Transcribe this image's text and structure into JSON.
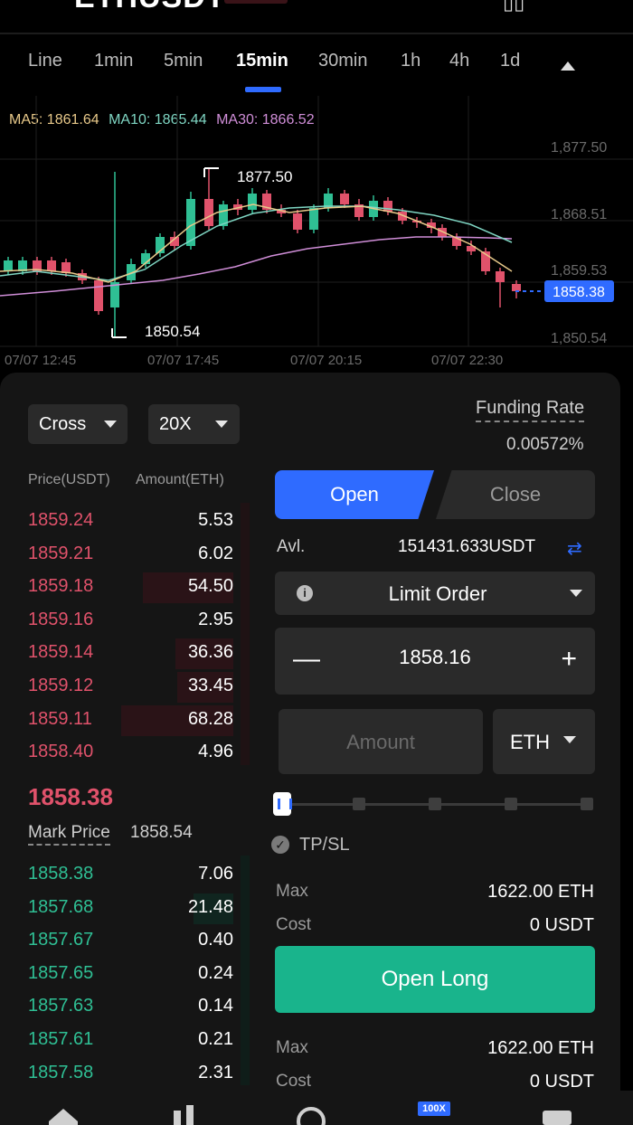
{
  "header": {
    "pair": "ETHUSDT"
  },
  "tabs": [
    {
      "label": "Line"
    },
    {
      "label": "1min"
    },
    {
      "label": "5min"
    },
    {
      "label": "15min",
      "active": true
    },
    {
      "label": "30min"
    },
    {
      "label": "1h"
    },
    {
      "label": "4h"
    },
    {
      "label": "1d"
    }
  ],
  "chart": {
    "ma5_label": "MA5: 1861.64",
    "ma10_label": "MA10: 1865.44",
    "ma30_label": "MA30: 1866.52",
    "y_ticks": [
      "1,877.50",
      "1,868.51",
      "1,859.53",
      "1,850.54"
    ],
    "x_ticks": [
      "07/07 12:45",
      "07/07 17:45",
      "07/07 20:15",
      "07/07 22:30"
    ],
    "high_label": "1877.50",
    "low_label": "1850.54",
    "current_price_tag": "1858.38",
    "colors": {
      "up": "#2fbf94",
      "down": "#e0526b",
      "ma5": "#e8c98a",
      "ma10": "#7fd6c3",
      "ma30": "#d08ed8",
      "tag": "#2f6bff"
    }
  },
  "trade": {
    "margin_mode": "Cross",
    "leverage": "20X",
    "funding_rate_label": "Funding Rate",
    "funding_rate_value": "0.00572%",
    "open_tab": "Open",
    "close_tab": "Close",
    "avl_label": "Avl.",
    "avl_value": "151431.633USDT",
    "order_type": "Limit Order",
    "price_value": "1858.16",
    "amount_placeholder": "Amount",
    "unit": "ETH",
    "slider_percent": 0,
    "tpsl_label": "TP/SL",
    "max_label": "Max",
    "cost_label": "Cost",
    "long_max": "1622.00 ETH",
    "long_cost": "0 USDT",
    "open_long_button": "Open Long",
    "short_max": "1622.00 ETH",
    "short_cost": "0 USDT"
  },
  "orderbook": {
    "price_header": "Price(USDT)",
    "amount_header": "Amount(ETH)",
    "asks": [
      {
        "price": "1859.24",
        "amount": "5.53"
      },
      {
        "price": "1859.21",
        "amount": "6.02"
      },
      {
        "price": "1859.18",
        "amount": "54.50"
      },
      {
        "price": "1859.16",
        "amount": "2.95"
      },
      {
        "price": "1859.14",
        "amount": "36.36"
      },
      {
        "price": "1859.12",
        "amount": "33.45"
      },
      {
        "price": "1859.11",
        "amount": "68.28"
      },
      {
        "price": "1858.40",
        "amount": "4.96"
      }
    ],
    "last_price": "1858.38",
    "mark_price_label": "Mark Price",
    "mark_price_value": "1858.54",
    "bids": [
      {
        "price": "1858.38",
        "amount": "7.06"
      },
      {
        "price": "1857.68",
        "amount": "21.48"
      },
      {
        "price": "1857.67",
        "amount": "0.40"
      },
      {
        "price": "1857.65",
        "amount": "0.24"
      },
      {
        "price": "1857.63",
        "amount": "0.14"
      },
      {
        "price": "1857.61",
        "amount": "0.21"
      },
      {
        "price": "1857.58",
        "amount": "2.31"
      }
    ]
  },
  "bottom_nav": {
    "icons": [
      "home-icon",
      "market-icon",
      "earn-icon",
      "futures-icon",
      "wallet-icon"
    ],
    "futures_badge": "100X"
  }
}
